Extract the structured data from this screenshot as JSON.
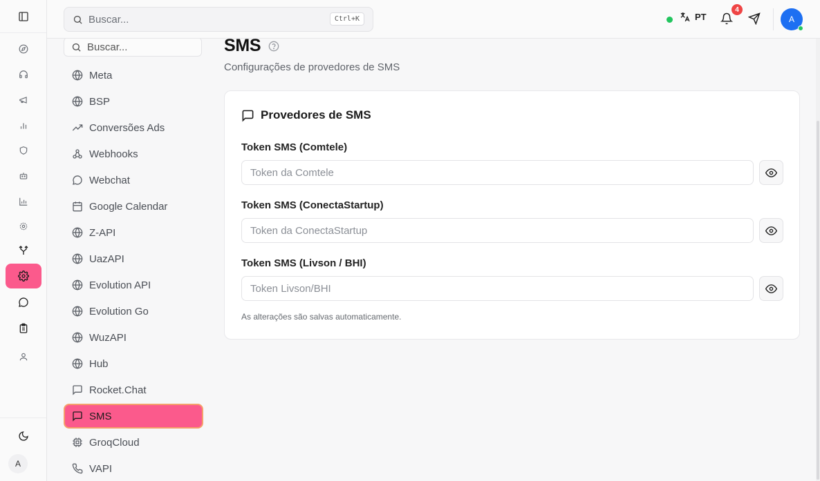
{
  "header": {
    "search_placeholder": "Buscar...",
    "search_shortcut": "Ctrl+K",
    "language": "PT",
    "notifications_count": "4",
    "user_initial": "A",
    "status_color": "#22c55e"
  },
  "rail": {
    "icons": [
      "sidebar-toggle-icon",
      "compass-icon",
      "headphones-icon",
      "megaphone-icon",
      "bar-chart-icon",
      "shield-icon",
      "bot-icon",
      "analytics-icon",
      "cog-icon",
      "git-branch-icon",
      "settings-icon",
      "message-circle-icon",
      "clipboard-icon",
      "user-icon"
    ],
    "active": "settings-icon",
    "theme_icon": "moon-icon",
    "user_initial": "A",
    "accent_color": "#fb5a8c"
  },
  "subnav": {
    "search_placeholder": "Buscar...",
    "items": [
      {
        "label": "Meta",
        "icon": "globe-icon"
      },
      {
        "label": "BSP",
        "icon": "globe-icon"
      },
      {
        "label": "Conversões Ads",
        "icon": "trending-up-icon"
      },
      {
        "label": "Webhooks",
        "icon": "webhook-icon"
      },
      {
        "label": "Webchat",
        "icon": "message-circle-icon"
      },
      {
        "label": "Google Calendar",
        "icon": "calendar-icon"
      },
      {
        "label": "Z-API",
        "icon": "globe-icon"
      },
      {
        "label": "UazAPI",
        "icon": "globe-icon"
      },
      {
        "label": "Evolution API",
        "icon": "globe-icon"
      },
      {
        "label": "Evolution Go",
        "icon": "globe-icon"
      },
      {
        "label": "WuzAPI",
        "icon": "globe-icon"
      },
      {
        "label": "Hub",
        "icon": "globe-icon"
      },
      {
        "label": "Rocket.Chat",
        "icon": "message-square-icon"
      },
      {
        "label": "SMS",
        "icon": "message-square-icon"
      },
      {
        "label": "GroqCloud",
        "icon": "cpu-icon"
      },
      {
        "label": "VAPI",
        "icon": "phone-icon"
      }
    ],
    "active": "SMS"
  },
  "page": {
    "title": "SMS",
    "subtitle": "Configurações de provedores de SMS"
  },
  "card": {
    "title": "Provedores de SMS",
    "fields": [
      {
        "label": "Token SMS (Comtele)",
        "placeholder": "Token da Comtele",
        "value": ""
      },
      {
        "label": "Token SMS (ConectaStartup)",
        "placeholder": "Token da ConectaStartup",
        "value": ""
      },
      {
        "label": "Token SMS (Livson / BHI)",
        "placeholder": "Token Livson/BHI",
        "value": ""
      }
    ],
    "note": "As alterações são salvas automaticamente."
  }
}
